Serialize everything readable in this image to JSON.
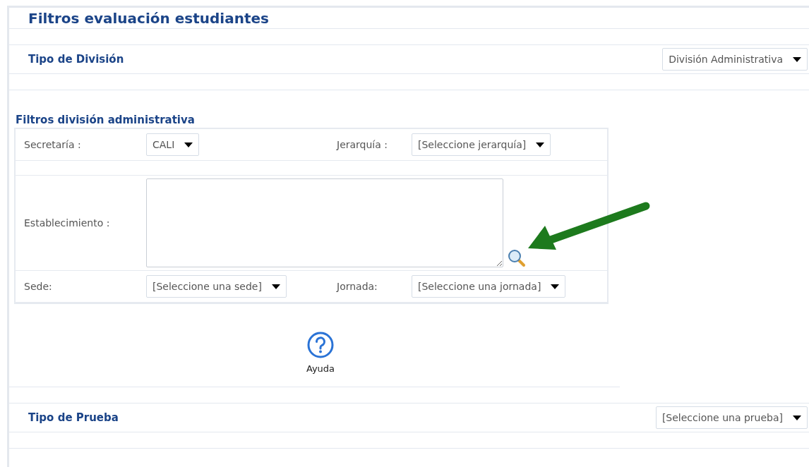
{
  "title": "Filtros evaluación estudiantes",
  "division_type": {
    "label": "Tipo de División",
    "select": {
      "value": "División Administrativa"
    }
  },
  "admin_filters": {
    "heading": "Filtros división administrativa",
    "fields": [
      {
        "kind": "select",
        "label": "Secretaría :",
        "value": "CALI"
      },
      {
        "kind": "select",
        "label": "Jerarquía :",
        "value": "[Seleccione jerarquía]"
      },
      {
        "kind": "textarea",
        "label": "Establecimiento :"
      },
      {
        "kind": "select",
        "label": "Sede:",
        "value": "[Seleccione una sede]"
      },
      {
        "kind": "select",
        "label": "Jornada:",
        "value": "[Seleccione una jornada]"
      }
    ]
  },
  "help": {
    "label": "Ayuda"
  },
  "test_type": {
    "label": "Tipo de Prueba",
    "select": {
      "value": "[Seleccione una prueba]"
    }
  }
}
